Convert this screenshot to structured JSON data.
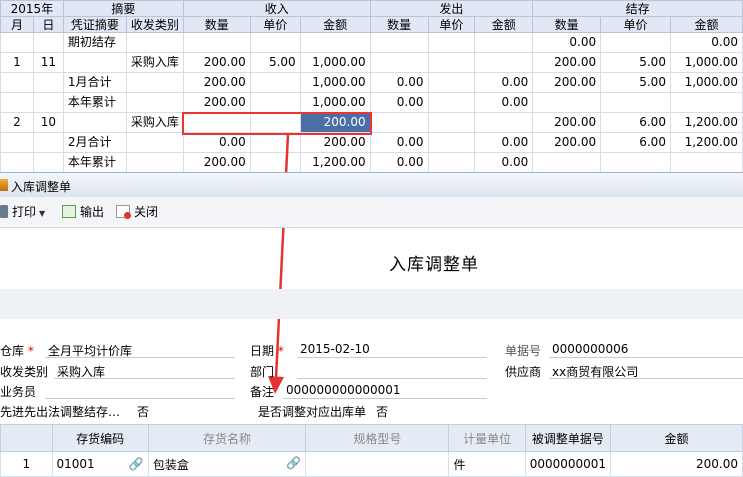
{
  "ledger": {
    "header_top": {
      "year": "2015年",
      "summary": "摘要",
      "in": "收入",
      "out": "发出",
      "balance": "结存"
    },
    "header_sub": {
      "month": "月",
      "day": "日",
      "voucher_summary": "凭证摘要",
      "category": "收发类别",
      "qty": "数量",
      "price": "单价",
      "amount": "金额"
    },
    "rows": [
      [
        "",
        "",
        "期初结存",
        "",
        "",
        "",
        "",
        "",
        "",
        "",
        "0.00",
        "",
        "0.00"
      ],
      [
        "1",
        "11",
        "",
        "采购入库",
        "200.00",
        "5.00",
        "1,000.00",
        "",
        "",
        "",
        "200.00",
        "5.00",
        "1,000.00"
      ],
      [
        "",
        "",
        "1月合计",
        "",
        "200.00",
        "",
        "1,000.00",
        "0.00",
        "",
        "0.00",
        "200.00",
        "5.00",
        "1,000.00"
      ],
      [
        "",
        "",
        "本年累计",
        "",
        "200.00",
        "",
        "1,000.00",
        "0.00",
        "",
        "0.00",
        "",
        "",
        ""
      ],
      [
        "2",
        "10",
        "",
        "采购入库",
        "",
        "",
        "200.00",
        "",
        "",
        "",
        "200.00",
        "6.00",
        "1,200.00"
      ],
      [
        "",
        "",
        "2月合计",
        "",
        "0.00",
        "",
        "200.00",
        "0.00",
        "",
        "0.00",
        "200.00",
        "6.00",
        "1,200.00"
      ],
      [
        "",
        "",
        "本年累计",
        "",
        "200.00",
        "",
        "1,200.00",
        "0.00",
        "",
        "0.00",
        "",
        "",
        ""
      ]
    ]
  },
  "window": {
    "title": "入库调整单"
  },
  "toolbar": {
    "print": "打印",
    "export": "输出",
    "close": "关闭"
  },
  "form": {
    "title": "入库调整单",
    "warehouse_label": "仓库",
    "warehouse_value": "全月平均计价库",
    "date_label": "日期",
    "date_value": "2015-02-10",
    "docno_label": "单据号",
    "docno_value": "0000000006",
    "category_label": "收发类别",
    "category_value": "采购入库",
    "dept_label": "部门",
    "dept_value": "",
    "supplier_label": "供应商",
    "supplier_value": "xx商贸有限公司",
    "clerk_label": "业务员",
    "clerk_value": "",
    "note_label": "备注",
    "note_value": "000000000000001",
    "fifo_label": "先进先出法调整结存…",
    "fifo_value": "否",
    "adjust_out_label": "是否调整对应出库单",
    "adjust_out_value": "否"
  },
  "detail": {
    "headers": [
      "",
      "存货编码",
      "存货名称",
      "规格型号",
      "计量单位",
      "被调整单据号",
      "金额"
    ],
    "rows": [
      [
        "1",
        "01001",
        "包装盒",
        "",
        "件",
        "0000000001",
        "200.00"
      ]
    ]
  },
  "colors": {
    "highlight_border": "#e33333",
    "selected_cell": "#4a6fa5",
    "arrow": "#e33333"
  }
}
